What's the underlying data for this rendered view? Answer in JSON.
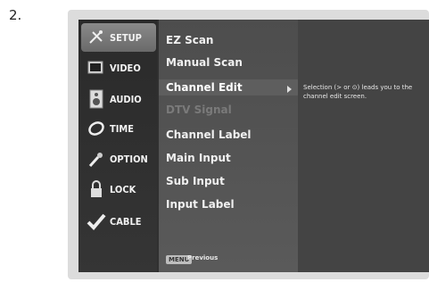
{
  "step": "2.",
  "tabs": [
    {
      "label": "SETUP",
      "icon": "satellite-dish-icon",
      "active": true
    },
    {
      "label": "VIDEO",
      "icon": "tv-icon",
      "active": false
    },
    {
      "label": "AUDIO",
      "icon": "speaker-icon",
      "active": false
    },
    {
      "label": "TIME",
      "icon": "clock-icon",
      "active": false
    },
    {
      "label": "OPTION",
      "icon": "option-icon",
      "active": false
    },
    {
      "label": "LOCK",
      "icon": "lock-icon",
      "active": false
    },
    {
      "label": "CABLE",
      "icon": "checkmark-icon",
      "active": false
    }
  ],
  "items": [
    {
      "label": "EZ Scan",
      "state": "normal"
    },
    {
      "label": "Manual Scan",
      "state": "normal"
    },
    {
      "label": "Channel Edit",
      "state": "selected"
    },
    {
      "label": "DTV Signal",
      "state": "disabled"
    },
    {
      "label": "Channel Label",
      "state": "normal"
    },
    {
      "label": "Main Input",
      "state": "normal"
    },
    {
      "label": "Sub Input",
      "state": "normal"
    },
    {
      "label": "Input Label",
      "state": "normal"
    }
  ],
  "description": "Selection (> or ⊙) leads you to the channel edit screen.",
  "footer": {
    "key": "MENU",
    "label": "Previous"
  }
}
